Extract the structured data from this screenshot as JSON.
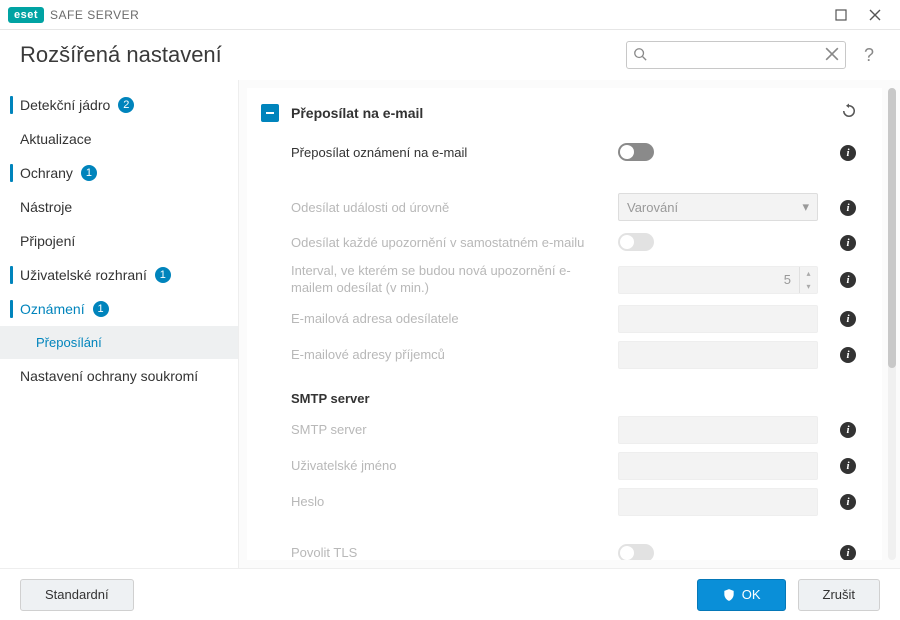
{
  "titlebar": {
    "brand_badge": "eset",
    "brand_text": "SAFE SERVER"
  },
  "topbar": {
    "title": "Rozšířená nastavení",
    "search_placeholder": "",
    "help": "?"
  },
  "sidebar": {
    "items": [
      {
        "label": "Detekční jádro",
        "badge": "2",
        "marked": true
      },
      {
        "label": "Aktualizace"
      },
      {
        "label": "Ochrany",
        "badge": "1",
        "marked": true
      },
      {
        "label": "Nástroje"
      },
      {
        "label": "Připojení"
      },
      {
        "label": "Uživatelské rozhraní",
        "badge": "1",
        "marked": true
      },
      {
        "label": "Oznámení",
        "badge": "1",
        "marked": true,
        "active": true
      },
      {
        "label": "Přeposílání",
        "sub": true,
        "selected": true
      },
      {
        "label": "Nastavení ochrany soukromí"
      }
    ]
  },
  "content": {
    "section_title": "Přeposílat na e-mail",
    "rows": {
      "forward_notify": {
        "label": "Přeposílat oznámení na e-mail"
      },
      "min_level": {
        "label": "Odesílat události od úrovně",
        "value": "Varování"
      },
      "separate_emails": {
        "label": "Odesílat každé upozornění v samostatném e-mailu"
      },
      "interval": {
        "label": "Interval, ve kterém se budou nová upozornění e-mailem odesílat (v min.)",
        "value": "5"
      },
      "sender": {
        "label": "E-mailová adresa odesílatele"
      },
      "recipients": {
        "label": "E-mailové adresy příjemců"
      }
    },
    "smtp_head": "SMTP server",
    "smtp": {
      "server": {
        "label": "SMTP server"
      },
      "user": {
        "label": "Uživatelské jméno"
      },
      "pass": {
        "label": "Heslo"
      },
      "tls": {
        "label": "Povolit TLS"
      }
    }
  },
  "footer": {
    "default": "Standardní",
    "ok": "OK",
    "cancel": "Zrušit"
  }
}
